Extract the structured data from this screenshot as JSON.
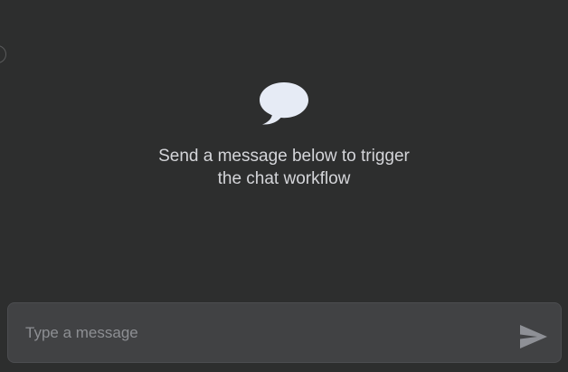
{
  "empty_state": {
    "icon": "chat-bubble-icon",
    "line1": "Send a message below to trigger",
    "line2": "the chat workflow"
  },
  "composer": {
    "placeholder": "Type a message",
    "value": "",
    "send_icon": "send-icon"
  },
  "colors": {
    "background": "#2d2e2e",
    "icon": "#e6ebf5",
    "text": "#d4d5d9",
    "input_background": "#414244",
    "placeholder": "#8d8f93",
    "send_icon": "#8e9096"
  }
}
